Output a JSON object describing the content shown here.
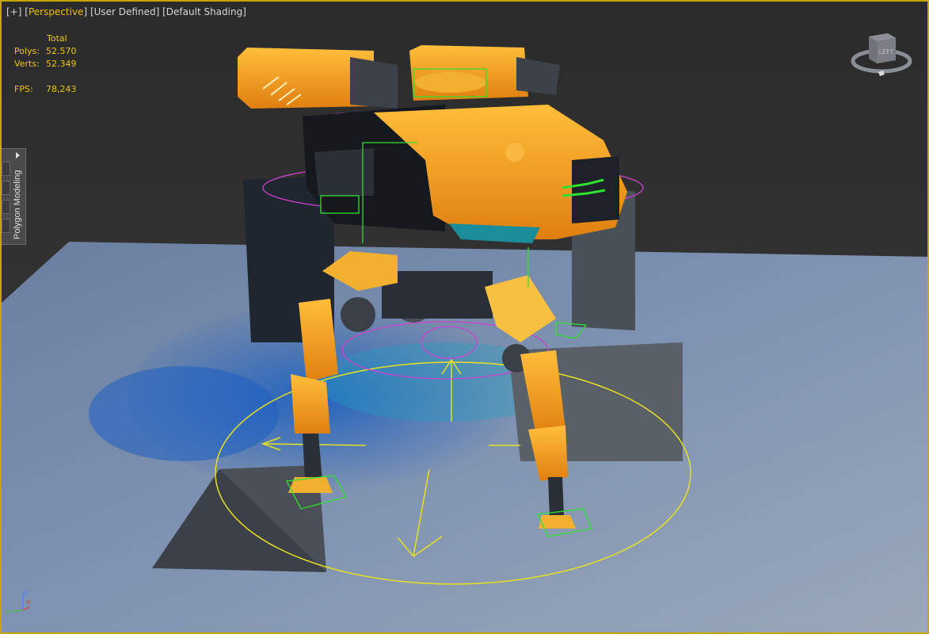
{
  "viewport": {
    "labels": {
      "plus": "[+]",
      "view": "Perspective",
      "lighting": "User Defined",
      "shading": "Default Shading"
    },
    "stats": {
      "header": "Total",
      "polys_label": "Polys:",
      "polys_value": "52.570",
      "verts_label": "Verts:",
      "verts_value": "52.349",
      "fps_label": "FPS:",
      "fps_value": "78,243"
    },
    "ribbon": {
      "label": "Polygon Modeling"
    },
    "viewcube": {
      "face_label": "LEFT"
    },
    "axis": {
      "z": "z",
      "x": "x",
      "y": "y"
    }
  },
  "colors": {
    "frame_highlight": "#c8a600",
    "stats_text": "#f1c40f",
    "robot_orange": "#f0a020",
    "gizmo_yellow": "#e8e020",
    "helper_magenta": "#d040d0",
    "helper_green": "#30e030"
  }
}
